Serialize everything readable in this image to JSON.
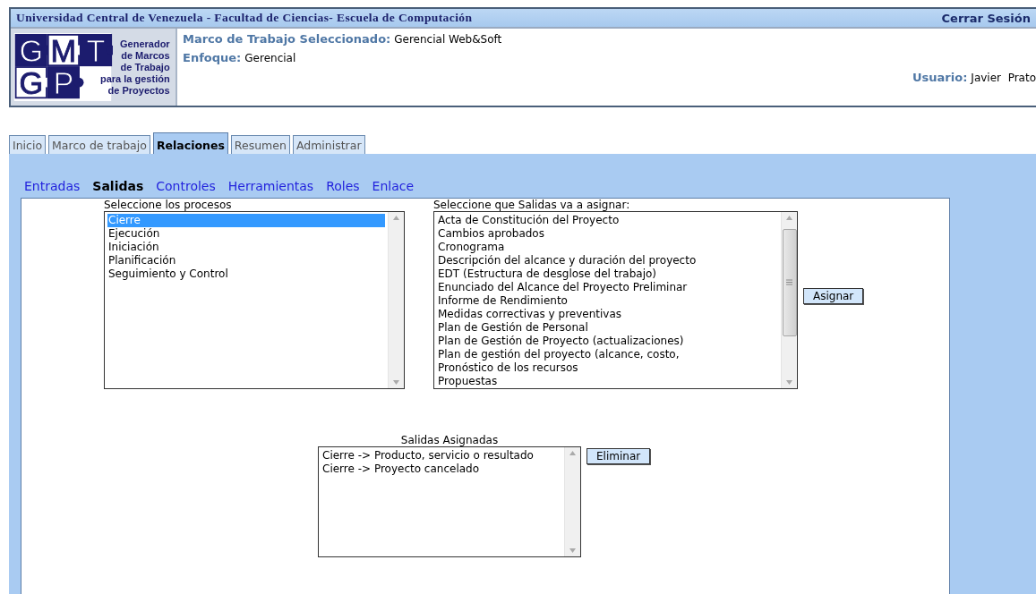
{
  "header": {
    "title": "Universidad Central de Venezuela - Facultad de Ciencias- Escuela de Computación",
    "logout": "Cerrar Sesión",
    "logo": {
      "letters": [
        "G",
        "M",
        "T",
        "G",
        "P"
      ],
      "caption": [
        "Generador",
        "de Marcos",
        "de Trabajo",
        "para la gestión",
        "de Proyectos"
      ]
    },
    "framework": {
      "label": "Marco de Trabajo Seleccionado:",
      "value": "Gerencial Web&Soft"
    },
    "approach": {
      "label": "Enfoque:",
      "value": "Gerencial"
    },
    "user": {
      "label": "Usuario:",
      "value": "Javier  Prato"
    }
  },
  "tabs": [
    {
      "label": "Inicio",
      "selected": false
    },
    {
      "label": "Marco de trabajo",
      "selected": false
    },
    {
      "label": "Relaciones",
      "selected": true
    },
    {
      "label": "Resumen",
      "selected": false
    },
    {
      "label": "Administrar",
      "selected": false
    }
  ],
  "subtabs": [
    {
      "label": "Entradas",
      "selected": false
    },
    {
      "label": "Salidas",
      "selected": true
    },
    {
      "label": "Controles",
      "selected": false
    },
    {
      "label": "Herramientas",
      "selected": false
    },
    {
      "label": "Roles",
      "selected": false
    },
    {
      "label": "Enlace",
      "selected": false
    }
  ],
  "processes": {
    "label": "Seleccione los procesos",
    "items": [
      {
        "text": "Cierre",
        "selected": true
      },
      {
        "text": "Ejecución",
        "selected": false
      },
      {
        "text": "Iniciación",
        "selected": false
      },
      {
        "text": "Planificación",
        "selected": false
      },
      {
        "text": "Seguimiento y Control",
        "selected": false
      }
    ]
  },
  "outputs": {
    "label": "Seleccione que Salidas va a asignar:",
    "items": [
      {
        "text": "Acta de Constitución del Proyecto",
        "selected": false
      },
      {
        "text": "Cambios aprobados",
        "selected": false
      },
      {
        "text": "Cronograma",
        "selected": false
      },
      {
        "text": "Descripción del alcance y duración del proyecto",
        "selected": false
      },
      {
        "text": "EDT (Estructura de desglose del trabajo)",
        "selected": false
      },
      {
        "text": "Enunciado del Alcance del Proyecto Preliminar",
        "selected": false
      },
      {
        "text": "Informe de Rendimiento",
        "selected": false
      },
      {
        "text": "Medidas correctivas y preventivas",
        "selected": false
      },
      {
        "text": "Plan de Gestión de Personal",
        "selected": false
      },
      {
        "text": "Plan de Gestión de Proyecto (actualizaciones)",
        "selected": false
      },
      {
        "text": "Plan de gestión del proyecto (alcance, costo,",
        "selected": false
      },
      {
        "text": "Pronóstico de los recursos",
        "selected": false
      },
      {
        "text": "Propuestas",
        "selected": false
      }
    ],
    "button": "Asignar"
  },
  "assigned": {
    "label": "Salidas Asignadas",
    "items": [
      {
        "text": "Cierre -> Producto, servicio o resultado",
        "selected": false
      },
      {
        "text": "Cierre -> Proyecto cancelado",
        "selected": false
      }
    ],
    "button": "Eliminar"
  }
}
